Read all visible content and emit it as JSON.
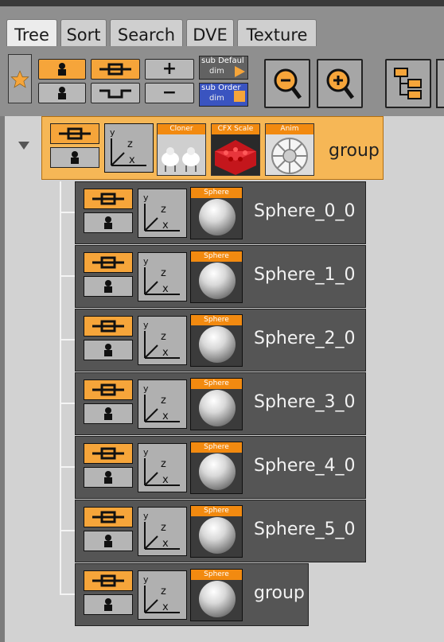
{
  "tabs": [
    "Tree",
    "Sort",
    "Search",
    "DVE",
    "Texture"
  ],
  "active_tab": "Tree",
  "toolbar": {
    "sub_default_label": "sub Defaul",
    "sub_default_dim": "dim",
    "sub_order_label": "sub Order",
    "sub_order_dim": "dim",
    "plus": "+",
    "minus": "−",
    "accent": "#f6a53a"
  },
  "root": {
    "name": "group",
    "modules": [
      "Cloner",
      "CFX Scale",
      "Anim"
    ]
  },
  "children": [
    {
      "name": "Sphere_0_0",
      "module": "Sphere"
    },
    {
      "name": "Sphere_1_0",
      "module": "Sphere"
    },
    {
      "name": "Sphere_2_0",
      "module": "Sphere"
    },
    {
      "name": "Sphere_3_0",
      "module": "Sphere"
    },
    {
      "name": "Sphere_4_0",
      "module": "Sphere"
    },
    {
      "name": "Sphere_5_0",
      "module": "Sphere"
    },
    {
      "name": "group",
      "module": "Sphere"
    }
  ],
  "axis": {
    "y": "y",
    "z": "z",
    "x": "x"
  }
}
